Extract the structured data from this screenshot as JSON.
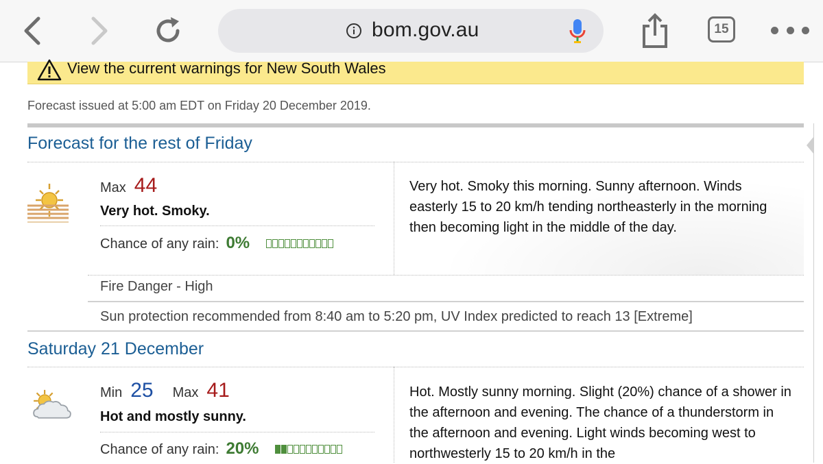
{
  "browser": {
    "url": "bom.gov.au",
    "tab_count": "15"
  },
  "warning": {
    "text": "View the current warnings for New South Wales"
  },
  "issued": "Forecast issued at 5:00 am EDT on Friday 20 December 2019.",
  "days": [
    {
      "title": "Forecast for the rest of Friday",
      "icon": "hazy-sun-icon",
      "max_label": "Max",
      "max": "44",
      "summary": "Very hot. Smoky.",
      "rain_label": "Chance of any rain:",
      "rain": "0%",
      "rain_fraction": 0.0,
      "description": "Very hot. Smoky this morning. Sunny afternoon. Winds easterly 15 to 20 km/h tending northeasterly in the morning then becoming light in the middle of the day.",
      "fire_danger": "Fire Danger - High",
      "sun_protection": "Sun protection recommended from 8:40 am to 5:20 pm, UV Index predicted to reach 13 [Extreme]"
    },
    {
      "title": "Saturday 21 December",
      "icon": "sun-behind-cloud-icon",
      "min_label": "Min",
      "min": "25",
      "max_label": "Max",
      "max": "41",
      "summary": "Hot and mostly sunny.",
      "rain_label": "Chance of any rain:",
      "rain": "20%",
      "rain_fraction": 0.2,
      "description": "Hot. Mostly sunny morning. Slight (20%) chance of a shower in the afternoon and evening. The chance of a thunderstorm in the afternoon and evening. Light winds becoming west to northwesterly 15 to 20 km/h in the"
    }
  ],
  "colors": {
    "warning_bg": "#fbe98d",
    "heading_blue": "#1b5e94",
    "max_red": "#a61b1b",
    "min_blue": "#1d4fa3",
    "rain_green": "#3e7b33"
  }
}
